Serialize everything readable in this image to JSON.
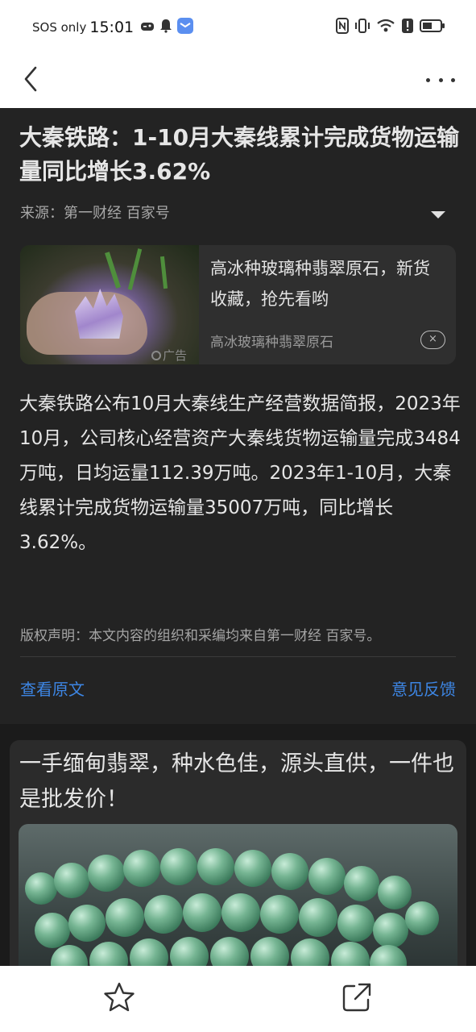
{
  "status_bar": {
    "carrier": "SOS only",
    "time": "15:01",
    "icons_left": [
      "game-icon",
      "bell-icon",
      "message-app-icon"
    ],
    "icons_right": [
      "nfc-icon",
      "vibrate-icon",
      "wifi-icon",
      "alert-icon",
      "battery-icon"
    ]
  },
  "nav": {
    "back_icon": "chevron-left-icon",
    "more_icon": "more-dots-icon"
  },
  "article": {
    "title": "大秦铁路：1-10月大秦线累计完成货物运输量同比增长3.62%",
    "source": "来源：第一财经 百家号",
    "body": "大秦铁路公布10月大秦线生产经营数据简报，2023年10月，公司核心经营资产大秦线货物运输量完成3484万吨，日均运量112.39万吨。2023年1-10月，大秦线累计完成货物运输量35007万吨，同比增长3.62%。",
    "copyright": "版权声明：本文内容的组织和采编均来自第一财经 百家号。",
    "view_original": "查看原文",
    "feedback": "意见反馈"
  },
  "ad_card": {
    "title": "高冰种玻璃种翡翠原石，新货收藏，抢先看哟",
    "subtitle": "高冰玻璃种翡翠原石",
    "ad_label": "广告",
    "close_symbol": "×"
  },
  "ad2": {
    "title": "一手缅甸翡翠，种水色佳，源头直供，一件也是批发价！"
  },
  "bottom_bar": {
    "icons": [
      "star-icon",
      "share-icon"
    ]
  },
  "colors": {
    "article_bg": "#232323",
    "link": "#3d86e4",
    "text": "#e6e6e6",
    "muted": "#a8a8a8"
  }
}
